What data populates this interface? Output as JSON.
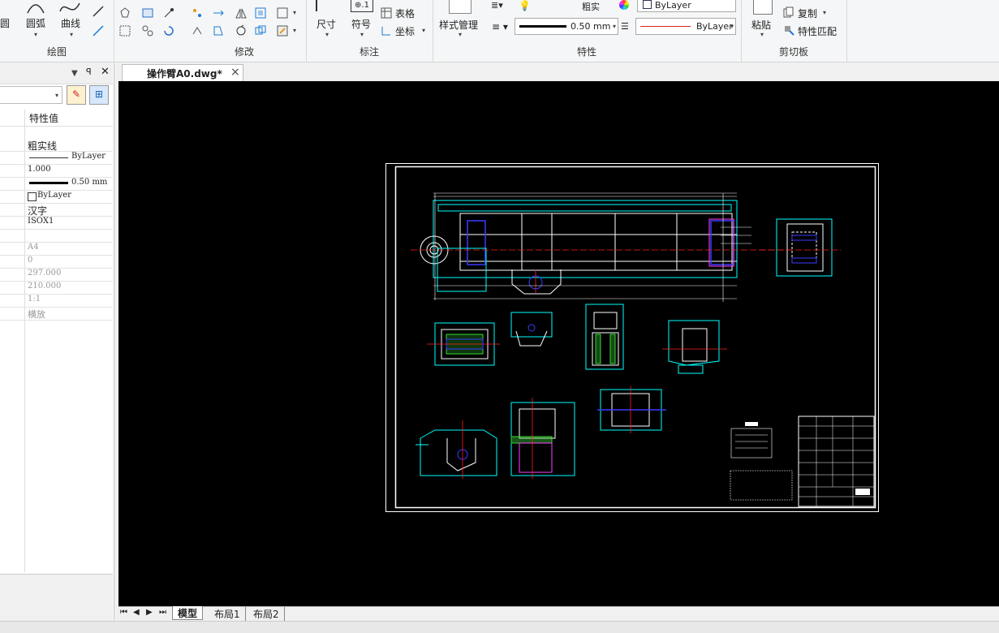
{
  "ribbon": {
    "groups": {
      "draw": "绘图",
      "modify": "修改",
      "annotate": "标注",
      "properties": "特性",
      "clipboard": "剪切板"
    },
    "draw_buttons": {
      "circle": "圆",
      "arc": "圆弧",
      "curve": "曲线"
    },
    "annotate_buttons": {
      "dimension": "尺寸",
      "symbol": "符号",
      "table": "表格",
      "coordinate": "坐标"
    },
    "style_manager": "样式管理",
    "properties": {
      "color_value": "ByLayer",
      "lineweight_value": "0.50 mm",
      "linetype_value": "ByLayer",
      "layer_label": "粗实"
    },
    "clipboard_buttons": {
      "paste": "粘贴",
      "copy": "复制",
      "match_properties": "特性匹配"
    }
  },
  "document_tab": {
    "title": "操作臂A0.dwg*",
    "close": "×"
  },
  "panel": {
    "header_value_label": "特性值",
    "rows": [
      "粗实线",
      "ByLayer",
      "1.000",
      "0.50 mm",
      "ByLayer",
      "汉字",
      "ISOX1",
      "A4",
      "0",
      "297.000",
      "210.000",
      "1:1",
      "横放"
    ]
  },
  "layout_tabs": [
    "模型",
    "布局1",
    "布局2"
  ],
  "colors": {
    "canvas": "#000000",
    "cyan": "#00ffff",
    "white": "#ffffff",
    "red": "#ff2020",
    "blue": "#3b3bff",
    "green": "#39d639",
    "magenta": "#ff40ff"
  }
}
